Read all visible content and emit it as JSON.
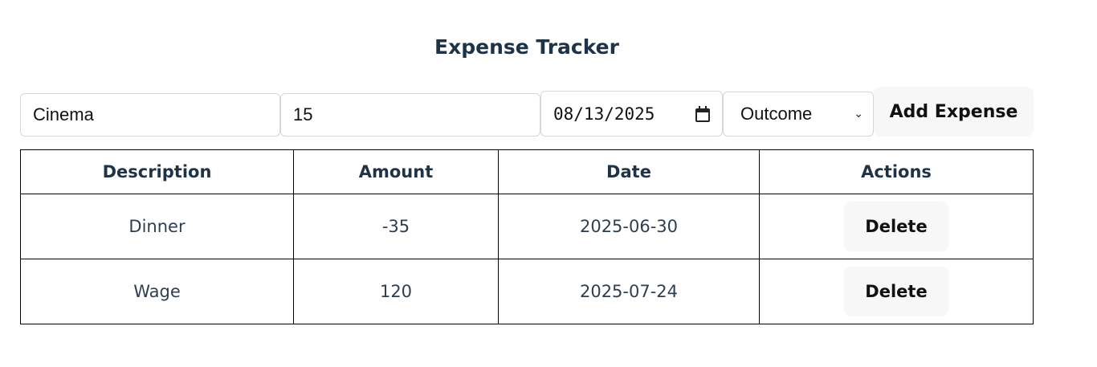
{
  "header": {
    "title": "Expense Tracker"
  },
  "form": {
    "description_value": "Cinema",
    "amount_value": "15",
    "date_value": "08/13/2025",
    "type_value": "Outcome",
    "add_label": "Add Expense"
  },
  "table": {
    "headers": [
      "Description",
      "Amount",
      "Date",
      "Actions"
    ],
    "rows": [
      {
        "description": "Dinner",
        "amount": "-35",
        "date": "2025-06-30",
        "action": "Delete"
      },
      {
        "description": "Wage",
        "amount": "120",
        "date": "2025-07-24",
        "action": "Delete"
      }
    ]
  },
  "icons": {
    "date_picker": "calendar-icon",
    "select": "chevron-down-icon"
  }
}
